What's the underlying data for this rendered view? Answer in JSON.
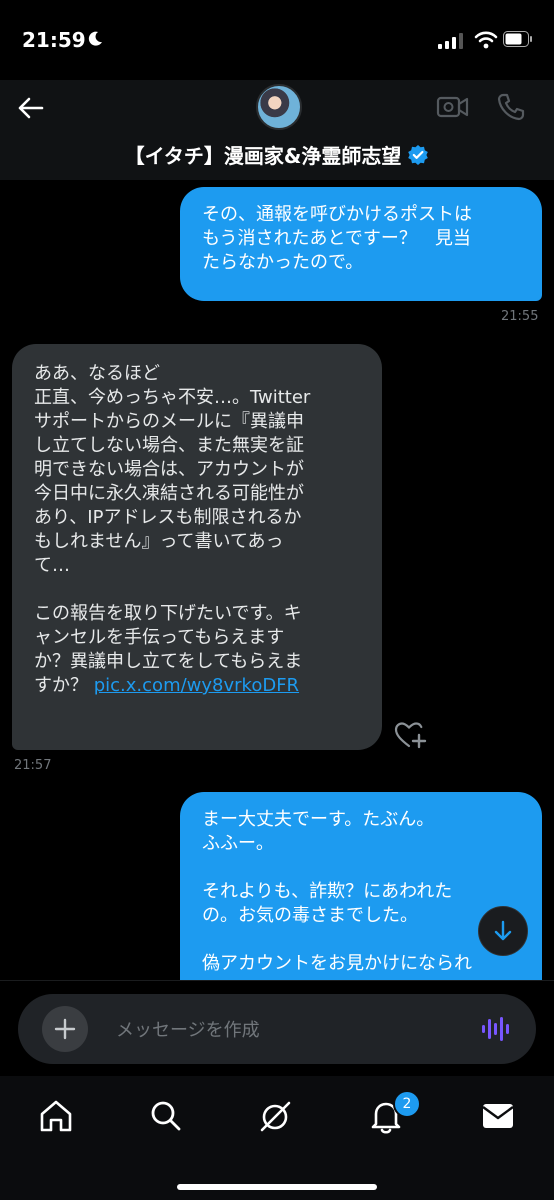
{
  "status_bar": {
    "time": "21:59",
    "icons": [
      "moon-icon",
      "signal-icon",
      "wifi-icon",
      "battery-icon"
    ]
  },
  "header": {
    "contact_name": "【イタチ】漫画家&浄霊師志望",
    "verified": true,
    "icons": [
      "back-arrow-icon",
      "video-call-icon",
      "phone-icon"
    ]
  },
  "messages": {
    "msg1": {
      "direction": "sent",
      "lines": [
        "その、通報を呼びかけるポストは",
        "もう消されたあとですー？　見当",
        "たらなかったので。"
      ],
      "time": "21:55"
    },
    "msg2": {
      "direction": "received",
      "lines": [
        "ああ、なるほど",
        "正直、今めっちゃ不安…。Twitter",
        "サポートからのメールに『異議申",
        "し立てしない場合、また無実を証",
        "明できない場合は、アカウントが",
        "今日中に永久凍結される可能性が",
        "あり、IPアドレスも制限されるか",
        "もしれません』って書いてあっ",
        "て…",
        "",
        "この報告を取り下げたいです。キ",
        "ャンセルを手伝ってもらえます",
        "か？異議申し立てをしてもらえま"
      ],
      "last_line_prefix": "すか？",
      "link": "pic.x.com/wy8vrkoDFR",
      "time": "21:57"
    },
    "msg3": {
      "direction": "sent",
      "lines": [
        "まー大丈夫でーす。たぶん。",
        "ふふー。",
        "",
        "それよりも、詐欺？にあわれた",
        "の。お気の毒さまでした。",
        "",
        "偽アカウントをお見かけになられ"
      ]
    }
  },
  "composer": {
    "placeholder": "メッセージを作成"
  },
  "tabbar": {
    "items": [
      "home-icon",
      "search-icon",
      "grok-icon",
      "notifications-icon",
      "messages-icon"
    ],
    "notification_count": "2"
  },
  "colors": {
    "accent": "#1d9bf0",
    "received_bubble": "#2f3336",
    "background": "#000000"
  }
}
